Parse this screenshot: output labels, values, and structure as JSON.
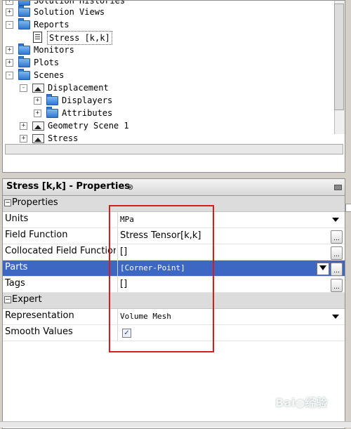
{
  "tree": {
    "items": [
      {
        "label": "Solution Histories",
        "icon": "folder-icon",
        "expander": "+"
      },
      {
        "label": "Solution Views",
        "icon": "folder-icon",
        "expander": "+"
      },
      {
        "label": "Reports",
        "icon": "folder-icon",
        "expander": "-"
      },
      {
        "label": "Stress [k,k]",
        "icon": "report-icon",
        "expander": ""
      },
      {
        "label": "Monitors",
        "icon": "folder-icon",
        "expander": "+"
      },
      {
        "label": "Plots",
        "icon": "folder-icon",
        "expander": "+"
      },
      {
        "label": "Scenes",
        "icon": "folder-icon",
        "expander": "-"
      },
      {
        "label": "Displacement",
        "icon": "scene-icon",
        "expander": "-"
      },
      {
        "label": "Displayers",
        "icon": "folder-icon",
        "expander": "+"
      },
      {
        "label": "Attributes",
        "icon": "folder-icon",
        "expander": "+"
      },
      {
        "label": "Geometry Scene 1",
        "icon": "scene-icon",
        "expander": "+"
      },
      {
        "label": "Stress",
        "icon": "scene-icon",
        "expander": "+"
      }
    ]
  },
  "properties": {
    "title": "Stress [k,k] - Properties",
    "close_glyph": "⊗",
    "groups": {
      "properties": "Properties",
      "expert": "Expert"
    },
    "rows": {
      "units": {
        "name": "Units",
        "value": "MPa"
      },
      "field_function": {
        "name": "Field Function",
        "value": "Stress Tensor[k,k]"
      },
      "collocated": {
        "name": "Collocated Field Function",
        "value": "[]"
      },
      "parts": {
        "name": "Parts",
        "value": "[Corner-Point]"
      },
      "tags": {
        "name": "Tags",
        "value": "[]"
      },
      "representation": {
        "name": "Representation",
        "value": "Volume Mesh"
      },
      "smooth_values": {
        "name": "Smooth Values",
        "checked": true
      }
    },
    "ellipsis": "...",
    "check_glyph": "✓"
  },
  "watermark": "Bai●经验",
  "colors": {
    "selection": "#3c68c4",
    "highlight_box": "#d81c1c"
  }
}
